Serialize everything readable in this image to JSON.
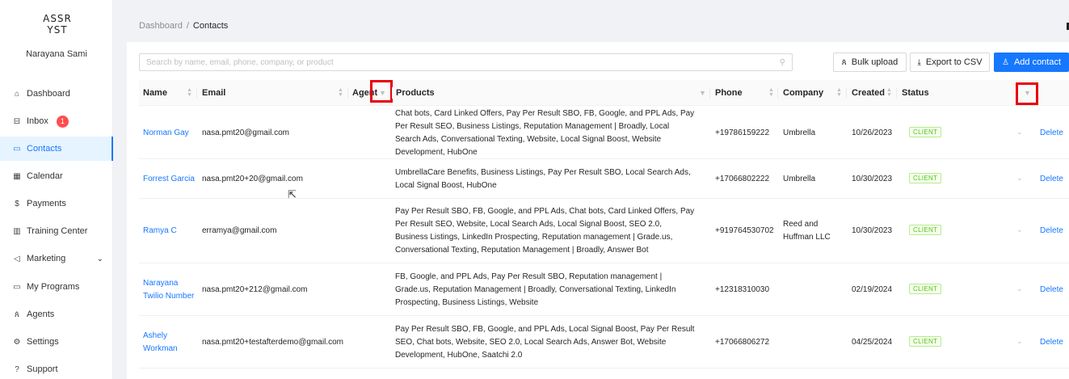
{
  "sidebar": {
    "logo_line1": "ASSR",
    "logo_line2": "YST",
    "user_name": "Narayana Sami",
    "items": [
      {
        "label": "Dashboard",
        "icon": "home-icon",
        "glyph": "⌂"
      },
      {
        "label": "Inbox",
        "icon": "inbox-icon",
        "glyph": "⊟",
        "badge": "1"
      },
      {
        "label": "Contacts",
        "icon": "contacts-icon",
        "glyph": "▭",
        "active": true
      },
      {
        "label": "Calendar",
        "icon": "calendar-icon",
        "glyph": "▦"
      },
      {
        "label": "Payments",
        "icon": "dollar-icon",
        "glyph": "$"
      },
      {
        "label": "Training Center",
        "icon": "book-icon",
        "glyph": "▥"
      },
      {
        "label": "Marketing",
        "icon": "megaphone-icon",
        "glyph": "◁",
        "chevron": "⌄"
      },
      {
        "label": "My Programs",
        "icon": "monitor-icon",
        "glyph": "▭"
      },
      {
        "label": "Agents",
        "icon": "agents-icon",
        "glyph": "ጰ"
      },
      {
        "label": "Settings",
        "icon": "gear-icon",
        "glyph": "⚙"
      },
      {
        "label": "Support",
        "icon": "question-icon",
        "glyph": "?"
      }
    ]
  },
  "breadcrumb": {
    "root": "Dashboard",
    "separator": "/",
    "current": "Contacts"
  },
  "search": {
    "placeholder": "Search by name, email, phone, company, or product"
  },
  "toolbar": {
    "bulk_upload": "Bulk upload",
    "export_csv": "Export to CSV",
    "add_contact": "Add contact"
  },
  "table": {
    "columns": {
      "name": "Name",
      "email": "Email",
      "agent": "Agent",
      "products": "Products",
      "phone": "Phone",
      "company": "Company",
      "created": "Created",
      "status": "Status"
    },
    "rows": [
      {
        "name": "Norman Gay",
        "email": "nasa.pmt20@gmail.com",
        "products": "Chat bots, Card Linked Offers, Pay Per Result SBO, FB, Google, and PPL Ads, Pay Per Result SEO, Business Listings, Reputation Management | Broadly, Local Search Ads, Conversational Texting, Website, Local Signal Boost, Website Development, HubOne",
        "phone": "+19786159222",
        "company": "Umbrella",
        "created": "10/26/2023",
        "status": "CLIENT",
        "action": "Delete"
      },
      {
        "name": "Forrest Garcia",
        "email": "nasa.pmt20+20@gmail.com",
        "products": "UmbrellaCare Benefits, Business Listings, Pay Per Result SBO, Local Search Ads, Local Signal Boost, HubOne",
        "phone": "+17066802222",
        "company": "Umbrella",
        "created": "10/30/2023",
        "status": "CLIENT",
        "action": "Delete"
      },
      {
        "name": "Ramya C",
        "email": "erramya@gmail.com",
        "products": "Pay Per Result SBO, FB, Google, and PPL Ads, Chat bots, Card Linked Offers, Pay Per Result SEO, Website, Local Search Ads, Local Signal Boost, SEO 2.0, Business Listings, LinkedIn Prospecting, Reputation management | Grade.us, Conversational Texting, Reputation Management | Broadly, Answer Bot",
        "phone": "+919764530702",
        "company": "Reed and Huffman LLC",
        "created": "10/30/2023",
        "status": "CLIENT",
        "action": "Delete"
      },
      {
        "name": "Narayana Twilio Number",
        "email": "nasa.pmt20+212@gmail.com",
        "products": "FB, Google, and PPL Ads, Pay Per Result SBO, Reputation management | Grade.us, Reputation Management | Broadly, Conversational Texting, LinkedIn Prospecting, Business Listings, Website",
        "phone": "+12318310030",
        "company": "",
        "created": "02/19/2024",
        "status": "CLIENT",
        "action": "Delete"
      },
      {
        "name": "Ashely Workman",
        "email": "nasa.pmt20+testafterdemo@gmail.com",
        "products": "Pay Per Result SBO, FB, Google, and PPL Ads, Local Signal Boost, Pay Per Result SEO, Chat bots, Website, SEO 2.0, Local Search Ads, Answer Bot, Website Development, HubOne, Saatchi 2.0",
        "phone": "+17066806272",
        "company": "",
        "created": "04/25/2024",
        "status": "CLIENT",
        "action": "Delete"
      }
    ]
  },
  "colors": {
    "accent": "#1677ff",
    "badge": "#ff4d4f",
    "status_green": "#52c41a",
    "highlight_box": "#e8000b"
  }
}
